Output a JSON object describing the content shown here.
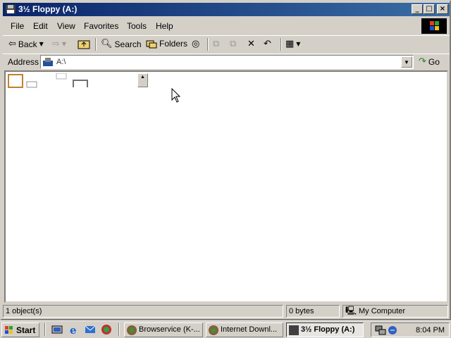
{
  "window": {
    "title": "3½ Floppy (A:)",
    "title_controls": {
      "minimize": "_",
      "maximize": "□",
      "close": "×"
    }
  },
  "menubar": {
    "items": [
      "File",
      "Edit",
      "View",
      "Favorites",
      "Tools",
      "Help"
    ]
  },
  "toolbar": {
    "back_label": "Back",
    "search_label": "Search",
    "folders_label": "Folders"
  },
  "address": {
    "label": "Address",
    "value": "A:\\",
    "go_label": "Go"
  },
  "statusbar": {
    "objects": "1 object(s)",
    "size": "0 bytes",
    "zone": "My Computer"
  },
  "taskbar": {
    "start_label": "Start",
    "tasks": [
      {
        "label": "Browservice (K-...",
        "active": false
      },
      {
        "label": "Internet Downl...",
        "active": false
      },
      {
        "label": "3½ Floppy (A:)",
        "active": true
      }
    ],
    "clock": "8:04 PM"
  },
  "colors": {
    "titlebar_start": "#0a246a",
    "titlebar_end": "#3a6ea5",
    "face": "#d4d0c8"
  }
}
